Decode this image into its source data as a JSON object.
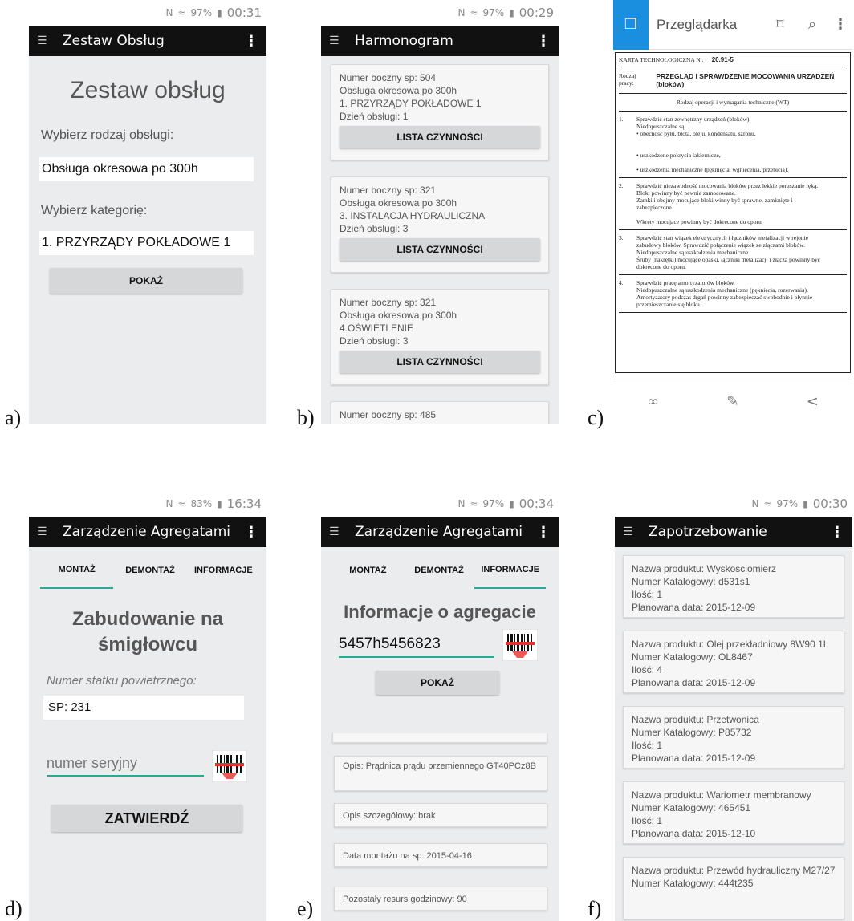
{
  "labels": {
    "a": "a)",
    "b": "b)",
    "c": "c)",
    "d": "d)",
    "e": "e)",
    "f": "f)"
  },
  "panel_a": {
    "status": {
      "battery": "97%",
      "time": "00:31"
    },
    "title": "Zestaw Obsług",
    "heading": "Zestaw obsług",
    "type_label": "Wybierz rodzaj obsługi:",
    "type_value": "Obsługa okresowa po 300h",
    "category_label": "Wybierz kategorię:",
    "category_value": "1. PRZYRZĄDY POKŁADOWE 1",
    "show_button": "POKAŻ"
  },
  "panel_b": {
    "status": {
      "battery": "97%",
      "time": "00:29"
    },
    "title": "Harmonogram",
    "cards": [
      {
        "l1": "Numer boczny sp: 504",
        "l2": "Obsługa okresowa po 300h",
        "l3": "1. PRZYRZĄDY POKŁADOWE 1",
        "l4": "Dzień obsługi: 1",
        "btn": "LISTA CZYNNOŚCI"
      },
      {
        "l1": "Numer boczny sp: 321",
        "l2": "Obsługa okresowa po 300h",
        "l3": "3. INSTALACJA HYDRAULICZNA",
        "l4": "Dzień obsługi: 3",
        "btn": "LISTA CZYNNOŚCI"
      },
      {
        "l1": "Numer boczny sp: 321",
        "l2": "Obsługa okresowa po 300h",
        "l3": "4.OŚWIETLENIE",
        "l4": "Dzień obsługi: 3",
        "btn": "LISTA CZYNNOŚCI"
      }
    ],
    "partial_card": "Numer boczny sp: 485"
  },
  "panel_c": {
    "app_title": "Przeglądarka",
    "doc": {
      "card_label": "KARTA TECHNOLOGICZNA Nr.",
      "card_no": "20.91-5",
      "work_label": "Rodzaj pracy:",
      "work_title": "PRZEGLĄD I SPRAWDZENIE MOCOWANIA URZĄDZEŃ (bloków)",
      "section": "Rodzaj operacji i wymagania techniczne (WT)",
      "items": [
        {
          "no": "1.",
          "lines": [
            "Sprawdzić stan zewnętrzny urządzeń (bloków).",
            "Niedopuszczalne są:",
            "• obecność pyłu, błota, oleju, kondensatu, szronu,",
            "",
            "",
            "• uszkodzone pokrycia lakiernicze,",
            "",
            "• uszkodzenia mechaniczne (pęknięcia, wgniecenia, przebicia)."
          ]
        },
        {
          "no": "2.",
          "lines": [
            "Sprawdzić niezawodność mocowania bloków przez lekkie poruszanie ręką.",
            "Bloki powinny być pewnie zamocowane.",
            "Zamki i obejmy mocujące bloki winny być sprawne, zamknięte i",
            "zabezpieczone.",
            "",
            "Wkręty mocujące powinny być dokręcone do oporu"
          ]
        },
        {
          "no": "3.",
          "lines": [
            "Sprawdzić stan wiązek elektrycznych i łączników metalizacji w rejonie",
            "zabudowy bloków. Sprawdzić połączenie wiązek ze złączami bloków.",
            "Niedopuszczalne są uszkodzenia mechaniczne.",
            "Śruby (nakrętki) mocujące opaski, łączniki metalizacji i złącza powinny być",
            "dokręcone do oporu."
          ]
        },
        {
          "no": "4.",
          "lines": [
            "Sprawdzić pracę amortyzatorów bloków.",
            "Niedopuszczalne są uszkodzenia mechaniczne (pęknięcia, rozerwania).",
            "Amortyzatory podczas drgań powinny zabezpieczać swobodnie i płynnie",
            "przemieszczanie się bloku."
          ]
        }
      ]
    }
  },
  "panel_d": {
    "status": {
      "battery": "83%",
      "time": "16:34"
    },
    "title": "Zarządzenie Agregatami",
    "tabs": [
      "MONTAŻ",
      "DEMONTAŻ",
      "INFORMACJE"
    ],
    "heading_1": "Zabudowanie na",
    "heading_2": "śmigłowcu",
    "aircraft_label": "Numer statku powietrznego:",
    "aircraft_value": "SP: 231",
    "serial_placeholder": "numer seryjny",
    "confirm_button": "ZATWIERDŹ"
  },
  "panel_e": {
    "status": {
      "battery": "97%",
      "time": "00:34"
    },
    "title": "Zarządzenie Agregatami",
    "tabs": [
      "MONTAŻ",
      "DEMONTAŻ",
      "INFORMACJE"
    ],
    "heading": "Informacje o agregacie",
    "serial_value": "5457h5456823",
    "show_button": "POKAŻ",
    "cards": [
      "Opis: Prądnica prądu przemiennego GT40PCz8B",
      "Opis szczegółowy: brak",
      "Data montażu na sp: 2015-04-16",
      "Pozostały resurs godzinowy: 90"
    ]
  },
  "panel_f": {
    "status": {
      "battery": "97%",
      "time": "00:30"
    },
    "title": "Zapotrzebowanie",
    "cards": [
      {
        "l1": "Nazwa produktu: Wyskosciomierz",
        "l2": "Numer Katalogowy: d531s1",
        "l3": "Ilość: 1",
        "l4": "Planowana data: 2015-12-09"
      },
      {
        "l1": "Nazwa produktu: Olej przekładniowy 8W90 1L",
        "l2": "Numer Katalogowy: OL8467",
        "l3": "Ilość: 4",
        "l4": "Planowana data: 2015-12-09"
      },
      {
        "l1": "Nazwa produktu: Przetwonica",
        "l2": "Numer Katalogowy: P85732",
        "l3": "Ilość: 1",
        "l4": "Planowana data: 2015-12-09"
      },
      {
        "l1": "Nazwa produktu: Wariometr membranowy",
        "l2": "Numer Katalogowy: 465451",
        "l3": "Ilość: 1",
        "l4": "Planowana data: 2015-12-10"
      },
      {
        "l1": "Nazwa produktu: Przewód hydrauliczny M27/27",
        "l2": "Numer Katalogowy: 444t235",
        "l3": "",
        "l4": ""
      }
    ]
  }
}
